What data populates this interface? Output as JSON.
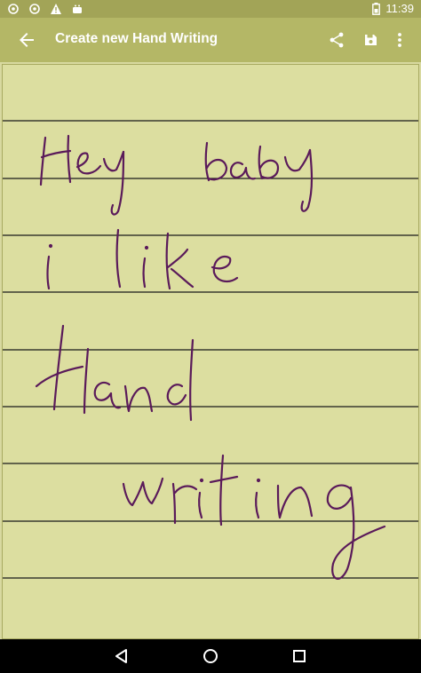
{
  "status_bar": {
    "time": "11:39",
    "icons": [
      "settings-icon",
      "settings-icon",
      "warning-icon",
      "android-icon",
      "battery-icon"
    ]
  },
  "app_bar": {
    "title": "Create new Hand Writing",
    "back_icon": "arrow-left-icon",
    "actions": [
      "share-icon",
      "save-icon",
      "more-vert-icon"
    ]
  },
  "canvas": {
    "paper_color": "#dcdea0",
    "line_color": "#1a1a1a",
    "ink_color": "#5a1a5a",
    "handwritten_text": [
      "Hey baby",
      "i like",
      "Hand",
      "writing"
    ]
  },
  "nav_bar": {
    "buttons": [
      "back-triangle-icon",
      "home-circle-icon",
      "recents-square-icon"
    ]
  },
  "colors": {
    "status_bar": "#a2a457",
    "app_bar": "#b4b766",
    "nav_bar": "#000000"
  }
}
